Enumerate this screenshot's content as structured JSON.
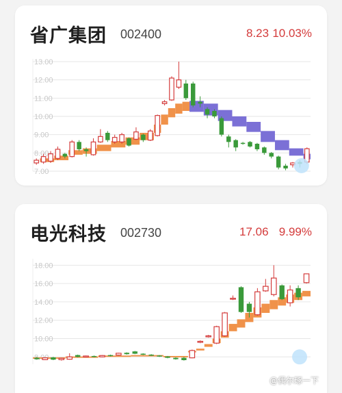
{
  "cards": [
    {
      "name": "省广集团",
      "code": "002400",
      "price": "8.23",
      "change_pct": "10.03%",
      "chart_data": {
        "type": "candlestick",
        "y_ticks": [
          "13.00",
          "12.00",
          "11.00",
          "10.00",
          "9.00",
          "8.00",
          "7.00"
        ],
        "ylim": [
          7.0,
          13.0
        ],
        "colors": {
          "up": "#d43b3b",
          "down": "#3a9a3a",
          "band_low": "#f0924a",
          "band_high": "#7b70d6",
          "grid": "#e6e6e6",
          "tick": "#c8c8c8"
        },
        "candles": [
          {
            "o": 7.45,
            "c": 7.6,
            "h": 7.7,
            "l": 7.35
          },
          {
            "o": 7.5,
            "c": 7.8,
            "h": 7.95,
            "l": 7.4
          },
          {
            "o": 7.55,
            "c": 7.95,
            "h": 8.1,
            "l": 7.45
          },
          {
            "o": 7.7,
            "c": 8.2,
            "h": 8.35,
            "l": 7.6
          },
          {
            "o": 7.95,
            "c": 7.8,
            "h": 8.0,
            "l": 7.7
          },
          {
            "o": 7.8,
            "c": 8.6,
            "h": 8.7,
            "l": 7.75
          },
          {
            "o": 8.6,
            "c": 8.2,
            "h": 8.7,
            "l": 8.1
          },
          {
            "o": 8.2,
            "c": 8.1,
            "h": 8.3,
            "l": 7.8
          },
          {
            "o": 7.9,
            "c": 8.6,
            "h": 8.8,
            "l": 7.85
          },
          {
            "o": 8.6,
            "c": 8.9,
            "h": 9.3,
            "l": 8.55
          },
          {
            "o": 9.1,
            "c": 8.7,
            "h": 9.2,
            "l": 8.6
          },
          {
            "o": 8.6,
            "c": 8.85,
            "h": 9.0,
            "l": 8.5
          },
          {
            "o": 8.6,
            "c": 9.0,
            "h": 9.1,
            "l": 8.5
          },
          {
            "o": 8.8,
            "c": 8.4,
            "h": 8.85,
            "l": 8.35
          },
          {
            "o": 8.75,
            "c": 9.15,
            "h": 9.4,
            "l": 8.7
          },
          {
            "o": 9.0,
            "c": 8.7,
            "h": 9.05,
            "l": 8.6
          },
          {
            "o": 8.7,
            "c": 9.2,
            "h": 9.3,
            "l": 8.65
          },
          {
            "o": 8.95,
            "c": 10.05,
            "h": 10.1,
            "l": 8.9
          },
          {
            "o": 10.7,
            "c": 10.8,
            "h": 10.9,
            "l": 10.6
          },
          {
            "o": 10.9,
            "c": 12.1,
            "h": 12.2,
            "l": 10.85
          },
          {
            "o": 11.6,
            "c": 12.0,
            "h": 13.0,
            "l": 11.5
          },
          {
            "o": 11.8,
            "c": 11.0,
            "h": 12.0,
            "l": 10.9
          },
          {
            "o": 11.8,
            "c": 10.6,
            "h": 11.9,
            "l": 10.5
          },
          {
            "o": 10.8,
            "c": 10.7,
            "h": 11.1,
            "l": 10.5
          },
          {
            "o": 10.4,
            "c": 10.1,
            "h": 10.5,
            "l": 9.9
          },
          {
            "o": 10.3,
            "c": 10.0,
            "h": 10.4,
            "l": 9.9
          },
          {
            "o": 9.9,
            "c": 9.0,
            "h": 10.0,
            "l": 8.9
          },
          {
            "o": 8.9,
            "c": 8.6,
            "h": 9.0,
            "l": 8.3
          },
          {
            "o": 8.7,
            "c": 8.3,
            "h": 8.75,
            "l": 8.1
          },
          {
            "o": 8.55,
            "c": 8.5,
            "h": 8.6,
            "l": 8.45
          },
          {
            "o": 8.6,
            "c": 8.35,
            "h": 8.65,
            "l": 8.3
          },
          {
            "o": 8.5,
            "c": 8.2,
            "h": 8.55,
            "l": 8.1
          },
          {
            "o": 8.3,
            "c": 8.0,
            "h": 8.35,
            "l": 7.9
          },
          {
            "o": 8.0,
            "c": 7.8,
            "h": 8.05,
            "l": 7.7
          },
          {
            "o": 7.8,
            "c": 7.2,
            "h": 7.85,
            "l": 7.1
          },
          {
            "o": 7.3,
            "c": 7.15,
            "h": 7.4,
            "l": 7.05
          },
          {
            "o": 7.35,
            "c": 7.45,
            "h": 7.5,
            "l": 7.2
          },
          {
            "o": 7.5,
            "c": 7.4,
            "h": 7.6,
            "l": 7.2
          },
          {
            "o": 7.5,
            "c": 8.23,
            "h": 8.3,
            "l": 7.4
          }
        ],
        "band": [
          {
            "from": 1,
            "lo": 7.5,
            "hi": 7.7,
            "up": true
          },
          {
            "from": 3,
            "lo": 7.6,
            "hi": 7.85,
            "up": true
          },
          {
            "from": 5,
            "lo": 7.9,
            "hi": 8.15,
            "up": true
          },
          {
            "from": 7,
            "lo": 7.95,
            "hi": 8.25,
            "up": true
          },
          {
            "from": 9,
            "lo": 8.1,
            "hi": 8.45,
            "up": true
          },
          {
            "from": 11,
            "lo": 8.3,
            "hi": 8.65,
            "up": true
          },
          {
            "from": 13,
            "lo": 8.45,
            "hi": 8.85,
            "up": true
          },
          {
            "from": 15,
            "lo": 8.7,
            "hi": 9.1,
            "up": true
          },
          {
            "from": 17,
            "lo": 9.1,
            "hi": 9.55,
            "up": true
          },
          {
            "from": 18,
            "lo": 9.55,
            "hi": 10.1,
            "up": true
          },
          {
            "from": 19,
            "lo": 9.95,
            "hi": 10.45,
            "up": true
          },
          {
            "from": 20,
            "lo": 10.15,
            "hi": 10.7,
            "up": true
          },
          {
            "from": 21,
            "lo": 10.3,
            "hi": 10.8,
            "up": true
          },
          {
            "from": 22,
            "lo": 10.25,
            "hi": 10.85,
            "up": false
          },
          {
            "from": 24,
            "lo": 10.05,
            "hi": 10.7,
            "up": false
          },
          {
            "from": 26,
            "lo": 9.75,
            "hi": 10.35,
            "up": false
          },
          {
            "from": 28,
            "lo": 9.45,
            "hi": 10.0,
            "up": false
          },
          {
            "from": 30,
            "lo": 9.15,
            "hi": 9.7,
            "up": false
          },
          {
            "from": 32,
            "lo": 8.6,
            "hi": 9.2,
            "up": false
          },
          {
            "from": 34,
            "lo": 8.15,
            "hi": 8.7,
            "up": false
          },
          {
            "from": 36,
            "lo": 7.85,
            "hi": 8.25,
            "up": false
          },
          {
            "from": 38,
            "lo": 7.65,
            "hi": 7.95,
            "up": false
          }
        ]
      }
    },
    {
      "name": "电光科技",
      "code": "002730",
      "price": "17.06",
      "change_pct": "9.99%",
      "chart_data": {
        "type": "candlestick",
        "y_ticks": [
          "18.00",
          "16.00",
          "14.00",
          "12.00",
          "10.00",
          "8.00"
        ],
        "ylim": [
          7.2,
          18.4
        ],
        "colors": {
          "up": "#d43b3b",
          "down": "#3a9a3a",
          "band_low": "#f0924a",
          "band_high": "#7b70d6",
          "grid": "#e6e6e6",
          "tick": "#c8c8c8"
        },
        "candles": [
          {
            "o": 7.9,
            "c": 7.75,
            "h": 8.0,
            "l": 7.7
          },
          {
            "o": 7.7,
            "c": 7.9,
            "h": 7.95,
            "l": 7.65
          },
          {
            "o": 7.95,
            "c": 7.7,
            "h": 8.0,
            "l": 7.65
          },
          {
            "o": 7.7,
            "c": 7.85,
            "h": 7.9,
            "l": 7.6
          },
          {
            "o": 7.75,
            "c": 8.0,
            "h": 8.4,
            "l": 7.7
          },
          {
            "o": 8.2,
            "c": 8.0,
            "h": 8.25,
            "l": 7.95
          },
          {
            "o": 8.0,
            "c": 8.1,
            "h": 8.15,
            "l": 7.95
          },
          {
            "o": 8.1,
            "c": 8.0,
            "h": 8.15,
            "l": 7.95
          },
          {
            "o": 8.0,
            "c": 8.15,
            "h": 8.2,
            "l": 7.95
          },
          {
            "o": 8.2,
            "c": 8.1,
            "h": 8.25,
            "l": 8.05
          },
          {
            "o": 8.2,
            "c": 8.4,
            "h": 8.45,
            "l": 8.15
          },
          {
            "o": 8.45,
            "c": 8.3,
            "h": 8.5,
            "l": 8.25
          },
          {
            "o": 8.6,
            "c": 8.35,
            "h": 8.65,
            "l": 8.3
          },
          {
            "o": 8.35,
            "c": 8.25,
            "h": 8.4,
            "l": 8.2
          },
          {
            "o": 8.25,
            "c": 8.15,
            "h": 8.3,
            "l": 8.1
          },
          {
            "o": 8.15,
            "c": 8.05,
            "h": 8.2,
            "l": 8.0
          },
          {
            "o": 8.05,
            "c": 7.9,
            "h": 8.1,
            "l": 7.85
          },
          {
            "o": 7.9,
            "c": 7.75,
            "h": 7.95,
            "l": 7.7
          },
          {
            "o": 7.9,
            "c": 7.65,
            "h": 8.0,
            "l": 7.6
          },
          {
            "o": 7.9,
            "c": 8.7,
            "h": 8.8,
            "l": 7.85
          },
          {
            "o": 9.6,
            "c": 9.7,
            "h": 9.8,
            "l": 9.5
          },
          {
            "o": 10.2,
            "c": 10.3,
            "h": 10.4,
            "l": 10.1
          },
          {
            "o": 9.5,
            "c": 11.3,
            "h": 11.4,
            "l": 9.4
          },
          {
            "o": 10.3,
            "c": 12.8,
            "h": 12.9,
            "l": 10.2
          },
          {
            "o": 14.3,
            "c": 14.4,
            "h": 14.7,
            "l": 14.2
          },
          {
            "o": 15.6,
            "c": 12.9,
            "h": 15.7,
            "l": 12.8
          },
          {
            "o": 13.8,
            "c": 12.9,
            "h": 14.0,
            "l": 12.3
          },
          {
            "o": 12.6,
            "c": 15.1,
            "h": 15.5,
            "l": 12.5
          },
          {
            "o": 15.2,
            "c": 15.7,
            "h": 16.5,
            "l": 15.1
          },
          {
            "o": 14.8,
            "c": 16.6,
            "h": 18.0,
            "l": 14.6
          },
          {
            "o": 15.8,
            "c": 14.3,
            "h": 15.9,
            "l": 14.2
          },
          {
            "o": 13.9,
            "c": 15.3,
            "h": 15.8,
            "l": 13.5
          },
          {
            "o": 15.5,
            "c": 14.5,
            "h": 15.8,
            "l": 14.2
          },
          {
            "o": 16.1,
            "c": 17.06,
            "h": 17.1,
            "l": 16.0
          }
        ],
        "band": [
          {
            "from": 0,
            "lo": 7.8,
            "hi": 7.95,
            "up": true
          },
          {
            "from": 4,
            "lo": 7.9,
            "hi": 8.05,
            "up": true
          },
          {
            "from": 8,
            "lo": 8.0,
            "hi": 8.15,
            "up": true
          },
          {
            "from": 12,
            "lo": 8.05,
            "hi": 8.2,
            "up": true
          },
          {
            "from": 16,
            "lo": 7.95,
            "hi": 8.1,
            "up": true
          },
          {
            "from": 19,
            "lo": 8.5,
            "hi": 8.65,
            "up": true
          },
          {
            "from": 20,
            "lo": 8.7,
            "hi": 8.9,
            "up": true
          },
          {
            "from": 21,
            "lo": 9.1,
            "hi": 9.4,
            "up": true
          },
          {
            "from": 22,
            "lo": 9.5,
            "hi": 10.0,
            "up": true
          },
          {
            "from": 23,
            "lo": 10.1,
            "hi": 10.8,
            "up": true
          },
          {
            "from": 24,
            "lo": 10.8,
            "hi": 11.6,
            "up": true
          },
          {
            "from": 25,
            "lo": 11.2,
            "hi": 12.1,
            "up": true
          },
          {
            "from": 26,
            "lo": 11.8,
            "hi": 12.8,
            "up": true
          },
          {
            "from": 27,
            "lo": 12.3,
            "hi": 13.4,
            "up": true
          },
          {
            "from": 28,
            "lo": 12.8,
            "hi": 13.8,
            "up": true
          },
          {
            "from": 29,
            "lo": 13.2,
            "hi": 14.2,
            "up": true
          },
          {
            "from": 30,
            "lo": 13.6,
            "hi": 14.5,
            "up": true
          },
          {
            "from": 31,
            "lo": 13.9,
            "hi": 14.8,
            "up": true
          },
          {
            "from": 32,
            "lo": 14.2,
            "hi": 15.0,
            "up": true
          },
          {
            "from": 33,
            "lo": 14.6,
            "hi": 15.2,
            "up": true
          }
        ]
      }
    }
  ],
  "watermark": "@偶尔琢一下"
}
